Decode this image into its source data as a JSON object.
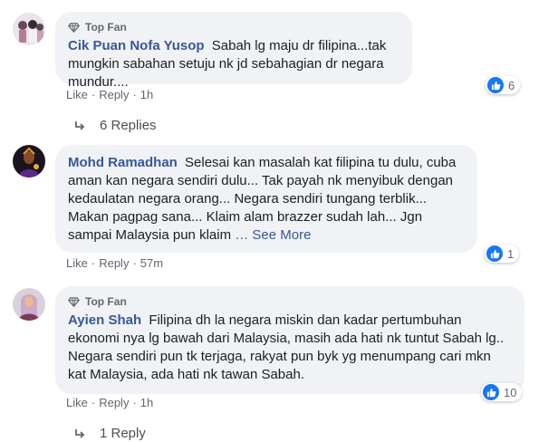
{
  "comments": [
    {
      "top_fan": "Top Fan",
      "author": "Cik Puan Nofa Yusop",
      "text": "Sabah lg maju dr filipina...tak mungkin sabahan setuju nk jd sebahagian dr negara mundur....",
      "actions": {
        "like": "Like",
        "reply": "Reply",
        "time": "1h"
      },
      "reactions": "6",
      "replies": "6 Replies"
    },
    {
      "author": "Mohd Ramadhan",
      "text": "Selesai kan masalah kat filipina tu dulu, cuba aman kan negara sendiri dulu... Tak payah nk menyibuk dengan kedaulatan negara orang... Negara sendiri tungang terblik... Makan pagpag sana... Klaim alam brazzer sudah lah... Jgn sampai Malaysia pun klaim",
      "see_more": "… See More",
      "actions": {
        "like": "Like",
        "reply": "Reply",
        "time": "57m"
      },
      "reactions": "1"
    },
    {
      "top_fan": "Top Fan",
      "author": "Ayien Shah",
      "text": "Filipina dh la negara miskin dan kadar pertumbuhan ekonomi nya lg bawah dari Malaysia, masih ada hati nk tuntut Sabah lg.. Negara sendiri pun tk terjaga, rakyat pun byk yg menumpang cari mkn kat Malaysia, ada hati nk tawan Sabah.",
      "actions": {
        "like": "Like",
        "reply": "Reply",
        "time": "1h"
      },
      "reactions": "10",
      "replies": "1 Reply"
    }
  ]
}
